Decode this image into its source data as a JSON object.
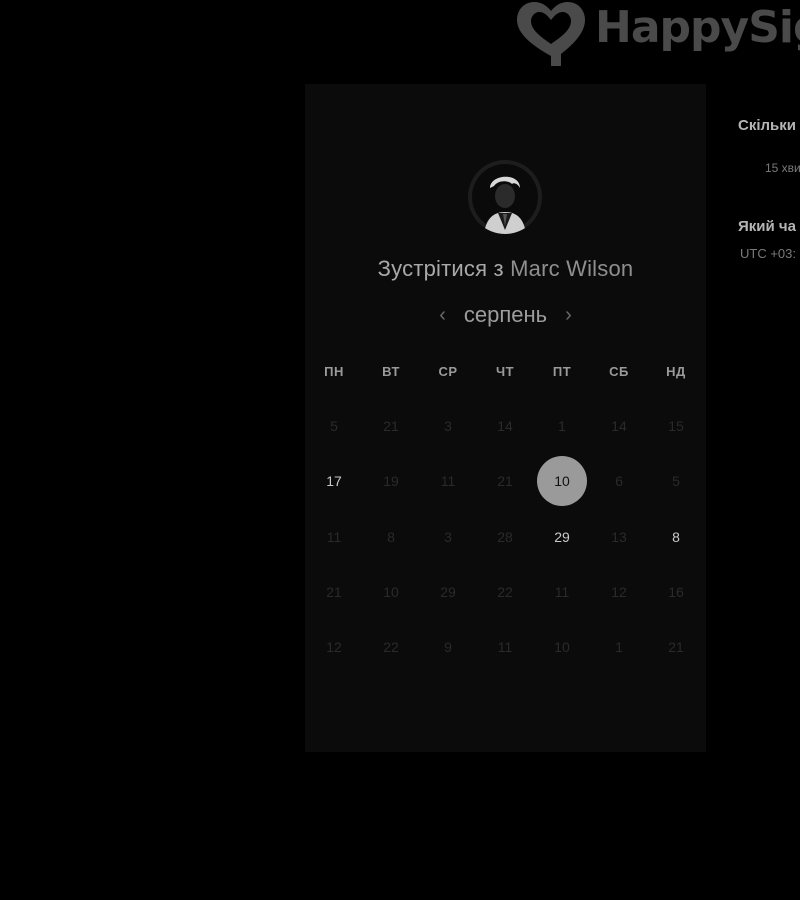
{
  "brand": {
    "name": "HappySig"
  },
  "card": {
    "title_prefix": "Зустрітися з",
    "host_name": "Marc Wilson",
    "month": "серпень",
    "prev_icon": "chevron-left-icon",
    "next_icon": "chevron-right-icon",
    "weekdays": [
      "ПН",
      "ВТ",
      "СР",
      "ЧТ",
      "ПТ",
      "СБ",
      "НД"
    ],
    "weeks": [
      [
        {
          "label": "5",
          "status": "disabled"
        },
        {
          "label": "21",
          "status": "disabled"
        },
        {
          "label": "3",
          "status": "disabled"
        },
        {
          "label": "14",
          "status": "disabled"
        },
        {
          "label": "1",
          "status": "disabled"
        },
        {
          "label": "14",
          "status": "disabled"
        },
        {
          "label": "15",
          "status": "disabled"
        }
      ],
      [
        {
          "label": "17",
          "status": "available"
        },
        {
          "label": "19",
          "status": "disabled"
        },
        {
          "label": "11",
          "status": "disabled"
        },
        {
          "label": "21",
          "status": "disabled"
        },
        {
          "label": "10",
          "status": "selected"
        },
        {
          "label": "6",
          "status": "disabled"
        },
        {
          "label": "5",
          "status": "disabled"
        }
      ],
      [
        {
          "label": "11",
          "status": "disabled"
        },
        {
          "label": "8",
          "status": "disabled"
        },
        {
          "label": "3",
          "status": "disabled"
        },
        {
          "label": "28",
          "status": "disabled"
        },
        {
          "label": "29",
          "status": "available"
        },
        {
          "label": "13",
          "status": "disabled"
        },
        {
          "label": "8",
          "status": "available"
        }
      ],
      [
        {
          "label": "21",
          "status": "disabled"
        },
        {
          "label": "10",
          "status": "disabled"
        },
        {
          "label": "29",
          "status": "disabled"
        },
        {
          "label": "22",
          "status": "disabled"
        },
        {
          "label": "11",
          "status": "disabled"
        },
        {
          "label": "12",
          "status": "disabled"
        },
        {
          "label": "16",
          "status": "disabled"
        }
      ],
      [
        {
          "label": "12",
          "status": "disabled"
        },
        {
          "label": "22",
          "status": "disabled"
        },
        {
          "label": "9",
          "status": "disabled"
        },
        {
          "label": "11",
          "status": "disabled"
        },
        {
          "label": "10",
          "status": "disabled"
        },
        {
          "label": "1",
          "status": "disabled"
        },
        {
          "label": "21",
          "status": "disabled"
        }
      ]
    ]
  },
  "side": {
    "duration_label": "Скільки",
    "duration_value": "15 хви",
    "timezone_label": "Який ча",
    "timezone_value": "UTC +03:"
  },
  "colors": {
    "background": "#000000",
    "card": "#0b0b0b",
    "selected_day": "#9a9a9a",
    "available_day_text": "#c9c9c9",
    "disabled_day_text": "#2a2a2a"
  }
}
